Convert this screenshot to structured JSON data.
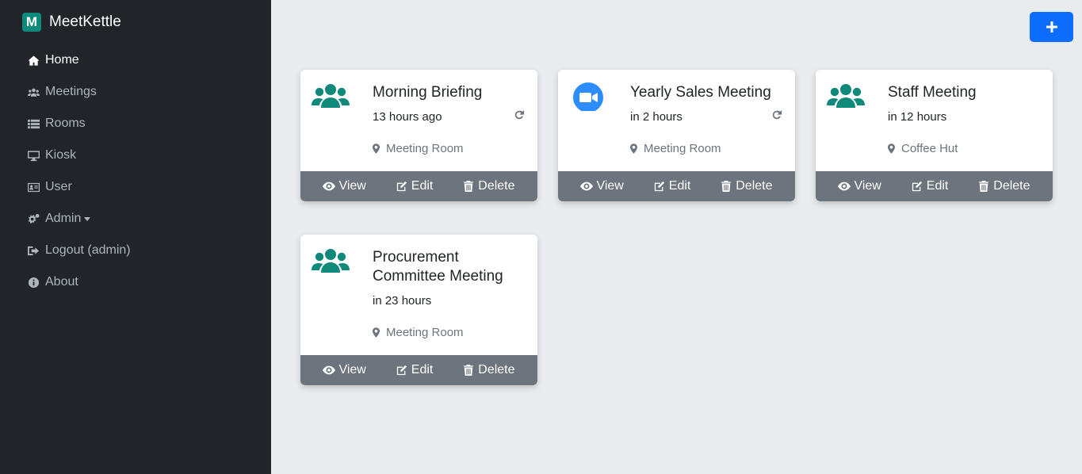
{
  "app": {
    "logo_letter": "M",
    "name": "MeetKettle"
  },
  "sidebar": {
    "items": [
      {
        "label": "Home",
        "icon": "home-icon"
      },
      {
        "label": "Meetings",
        "icon": "users-icon"
      },
      {
        "label": "Rooms",
        "icon": "list-icon"
      },
      {
        "label": "Kiosk",
        "icon": "desktop-icon"
      },
      {
        "label": "User",
        "icon": "id-card-icon"
      },
      {
        "label": "Admin",
        "icon": "cogs-icon"
      },
      {
        "label": "Logout (admin)",
        "icon": "sign-out-icon"
      },
      {
        "label": "About",
        "icon": "info-icon"
      }
    ]
  },
  "add_button": {
    "icon": "plus-icon"
  },
  "meetings": [
    {
      "title": "Morning Briefing",
      "time": "13 hours ago",
      "location": "Meeting Room",
      "icon": "users-icon"
    },
    {
      "title": "Yearly Sales Meeting",
      "time": "in 2 hours",
      "location": "Meeting Room",
      "icon": "video-icon"
    },
    {
      "title": "Staff Meeting",
      "time": "in 12 hours",
      "location": "Coffee Hut",
      "icon": "users-icon"
    },
    {
      "title": "Procurement Committee Meeting",
      "time": "in 23 hours",
      "location": "Meeting Room",
      "icon": "users-icon"
    }
  ],
  "card_actions": {
    "view": "View",
    "edit": "Edit",
    "delete": "Delete"
  },
  "colors": {
    "sidebar": "#212529",
    "accent": "#0d6efd",
    "teal": "#0f8a7a",
    "zoom_blue": "#2d8cff",
    "action_bar": "#6c757d",
    "background": "#e9ecef"
  }
}
